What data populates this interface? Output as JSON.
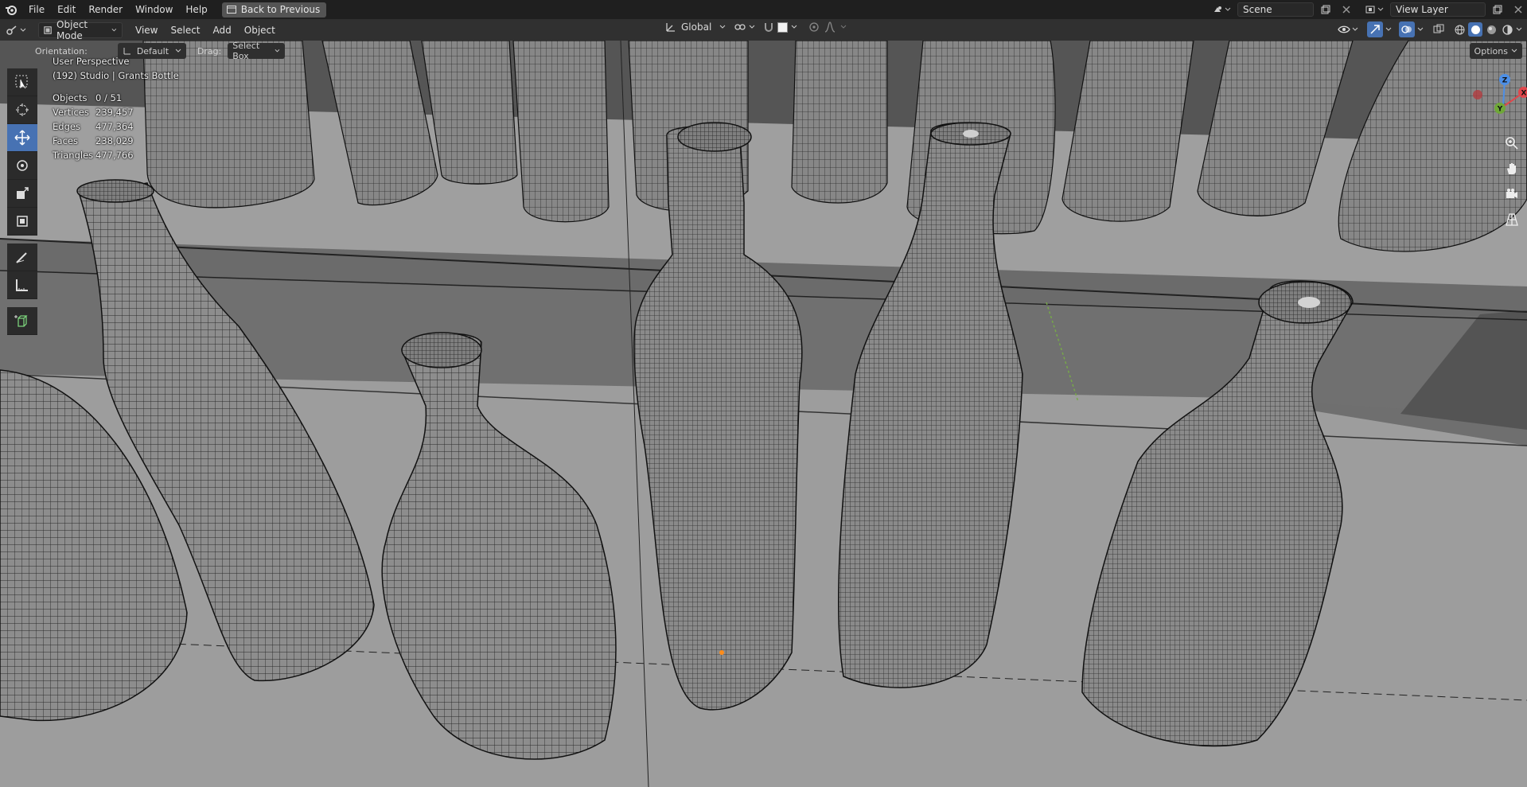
{
  "menubar": {
    "items": [
      "File",
      "Edit",
      "Render",
      "Window",
      "Help"
    ],
    "back_button": "Back to Previous"
  },
  "topright": {
    "scene_label": "Scene",
    "view_layer_label": "View Layer"
  },
  "header": {
    "mode": "Object Mode",
    "menus": [
      "View",
      "Select",
      "Add",
      "Object"
    ],
    "transform_orientation": "Global",
    "options_label": "Options"
  },
  "tool_header": {
    "orientation_label": "Orientation:",
    "orientation_value": "Default",
    "drag_label": "Drag:",
    "drag_value": "Select Box"
  },
  "viewport": {
    "perspective": "User Perspective",
    "collection": "(192) Studio | Grants Bottle",
    "stats": [
      {
        "label": "Objects",
        "value": "0 / 51"
      },
      {
        "label": "Vertices",
        "value": "239,457"
      },
      {
        "label": "Edges",
        "value": "477,364"
      },
      {
        "label": "Faces",
        "value": "238,029"
      },
      {
        "label": "Triangles",
        "value": "477,766"
      }
    ]
  },
  "colors": {
    "accent": "#4772b3",
    "axis_x": "#e0474c",
    "axis_y": "#6fa838",
    "axis_z": "#4d8fe6"
  },
  "gizmo": {
    "axis_x": "X",
    "axis_y": "Y",
    "axis_z": "Z"
  }
}
